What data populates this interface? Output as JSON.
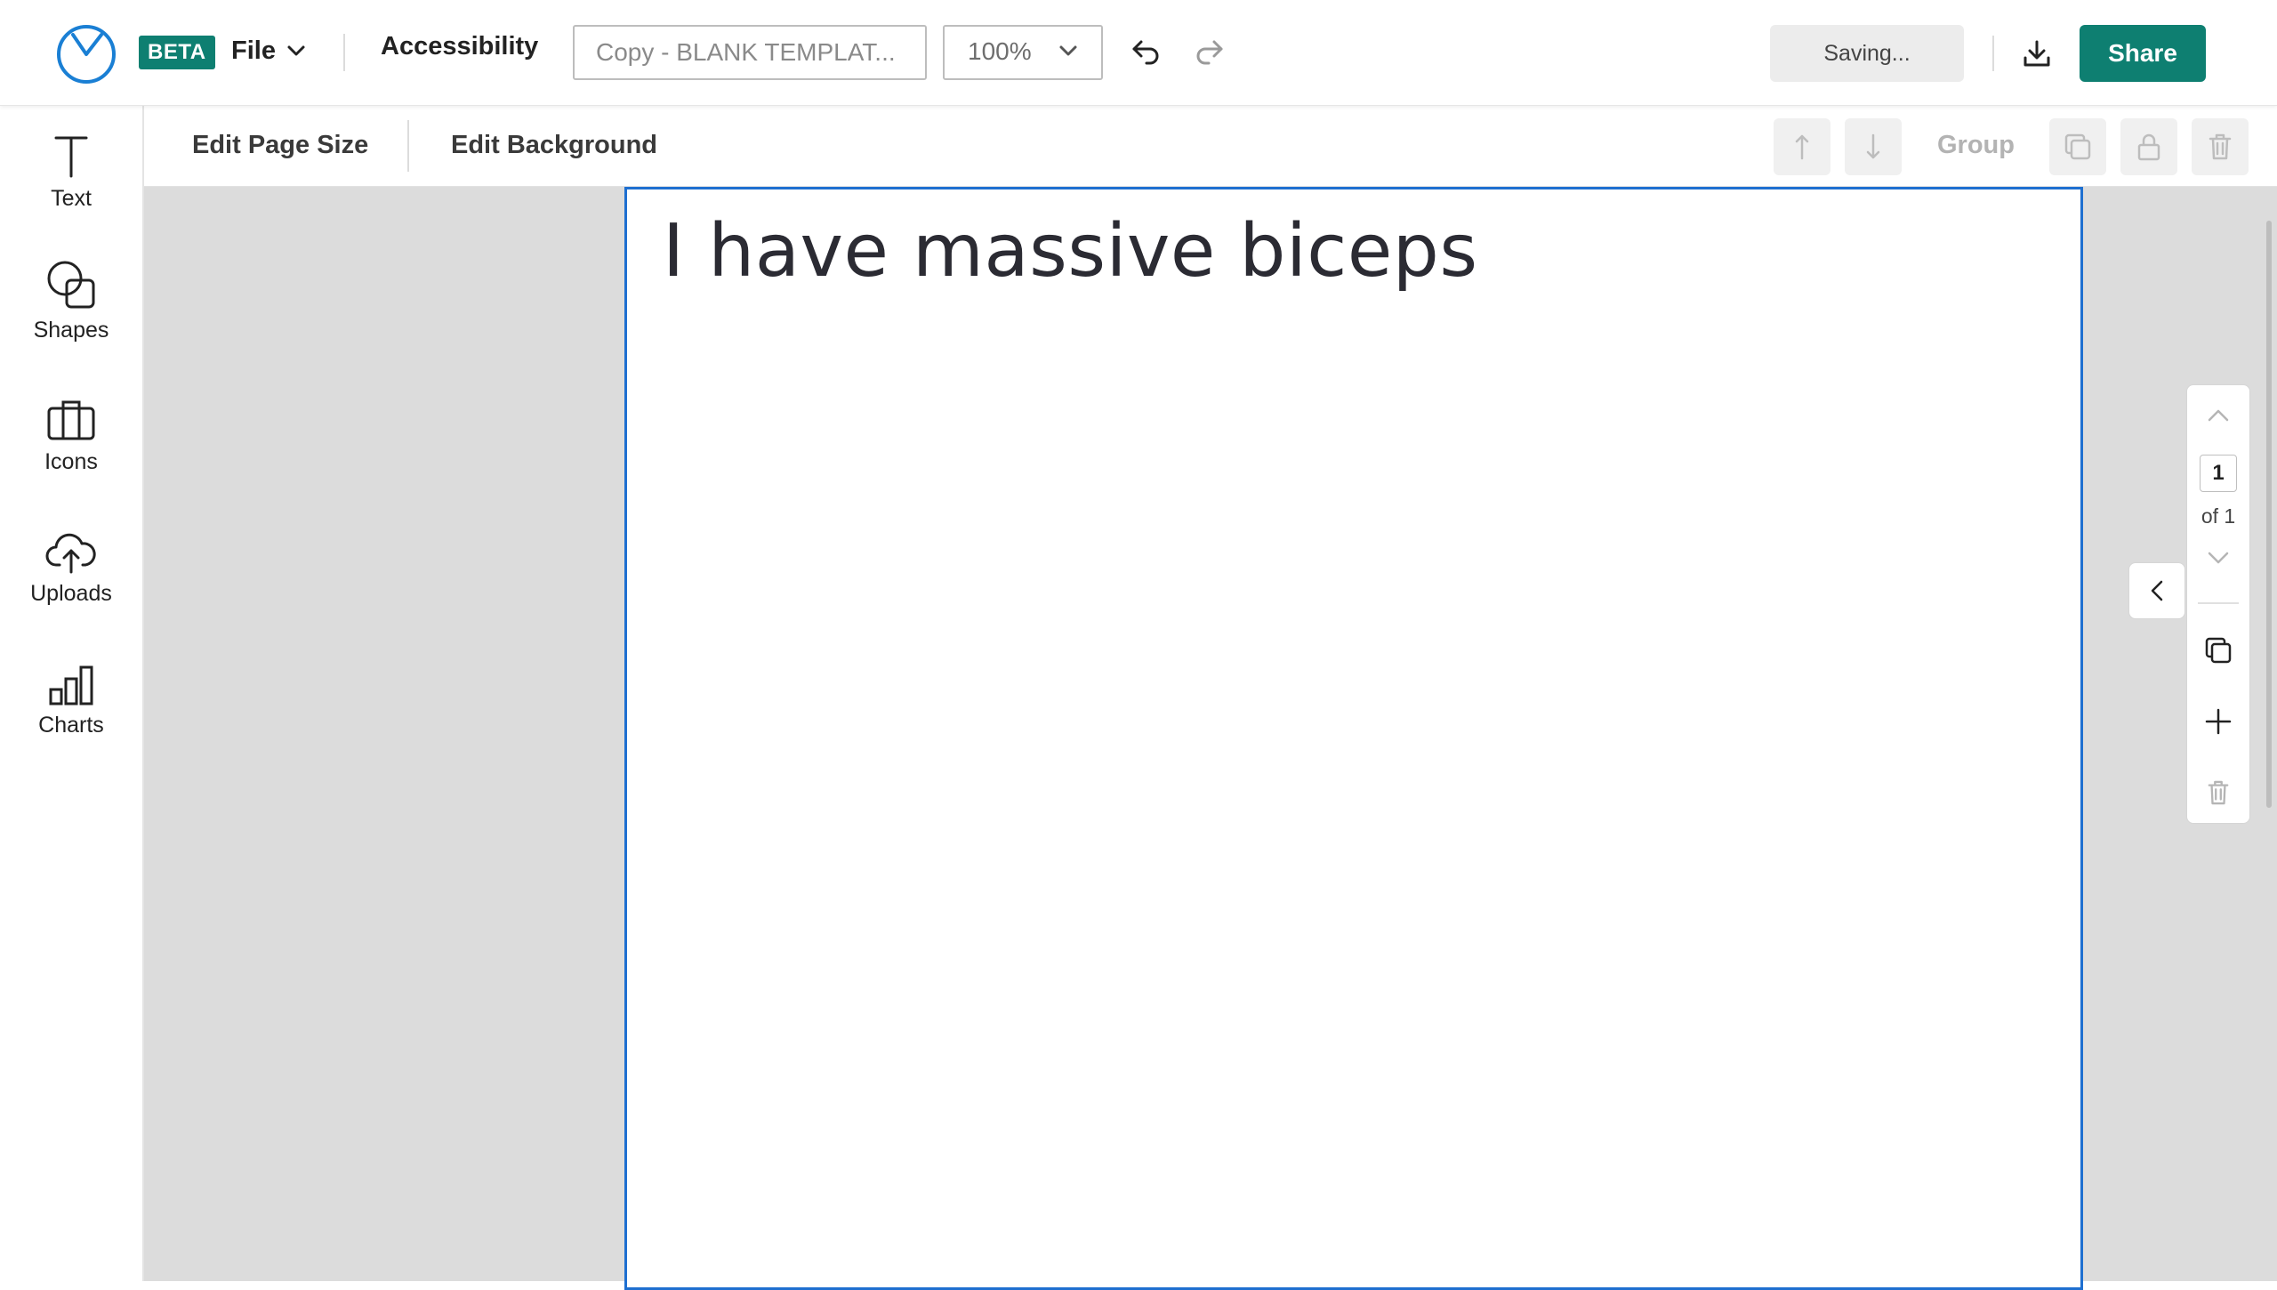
{
  "header": {
    "beta_label": "BETA",
    "file_label": "File",
    "accessibility_label": "Accessibility",
    "document_title": "Copy - BLANK TEMPLAT...",
    "zoom_value": "100%",
    "saving_label": "Saving...",
    "share_label": "Share"
  },
  "sidebar": {
    "items": [
      {
        "label": "Text",
        "icon": "text-icon"
      },
      {
        "label": "Shapes",
        "icon": "shapes-icon"
      },
      {
        "label": "Icons",
        "icon": "briefcase-icon"
      },
      {
        "label": "Uploads",
        "icon": "cloud-upload-icon"
      },
      {
        "label": "Charts",
        "icon": "bar-chart-icon"
      }
    ]
  },
  "toolbar": {
    "edit_page_size_label": "Edit Page Size",
    "edit_background_label": "Edit Background",
    "group_label": "Group"
  },
  "canvas": {
    "text_content": "I have massive biceps"
  },
  "page_nav": {
    "current_page": "1",
    "total_label": "of 1"
  },
  "colors": {
    "brand": "#0e7f71",
    "selection": "#1e6fd0",
    "logo": "#1a7fd4"
  }
}
